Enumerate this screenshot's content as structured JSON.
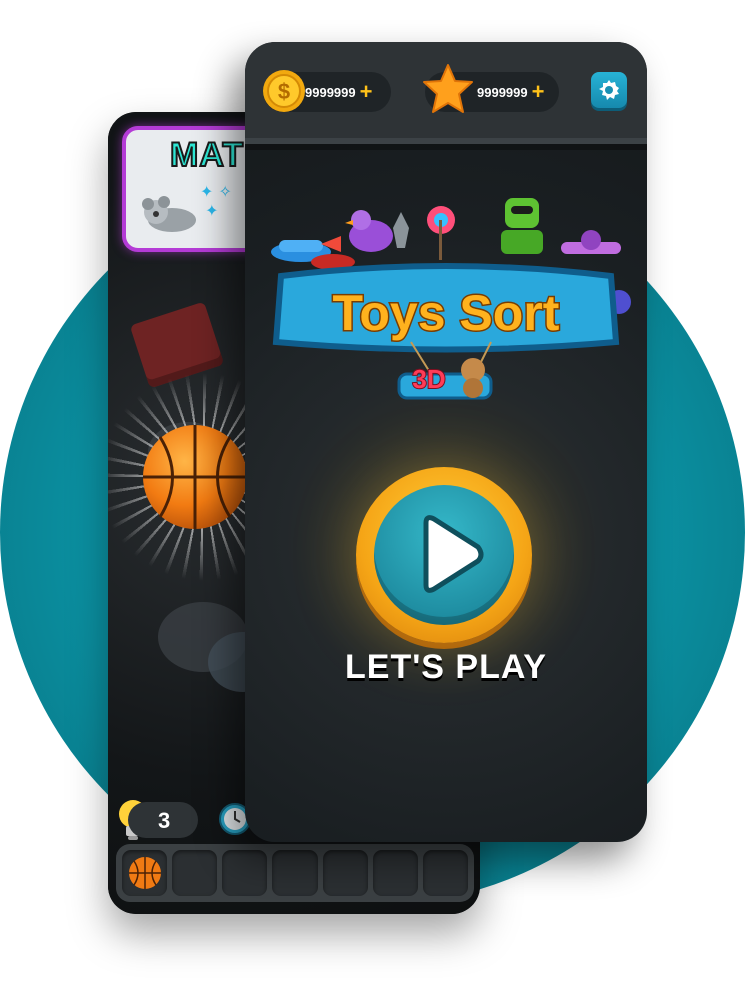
{
  "background": {
    "circle_color": "#0b8fa0"
  },
  "back_screen": {
    "panel_title": "MAT",
    "hint_count": "3",
    "slot_count": 7,
    "first_slot_item": "basketball-icon"
  },
  "front_screen": {
    "currencies": {
      "coins": {
        "value": "9999999",
        "icon": "coin-icon"
      },
      "stars": {
        "value": "9999999",
        "icon": "star-icon"
      }
    },
    "settings_icon": "gear-icon",
    "logo": {
      "line1": "Toys Sort",
      "line2": "3D"
    },
    "play_label": "LET'S PLAY"
  },
  "colors": {
    "accent_orange": "#f5a516",
    "accent_teal": "#1f8ea2",
    "gold": "#ffc21a",
    "purple_border": "#b43bd6"
  }
}
